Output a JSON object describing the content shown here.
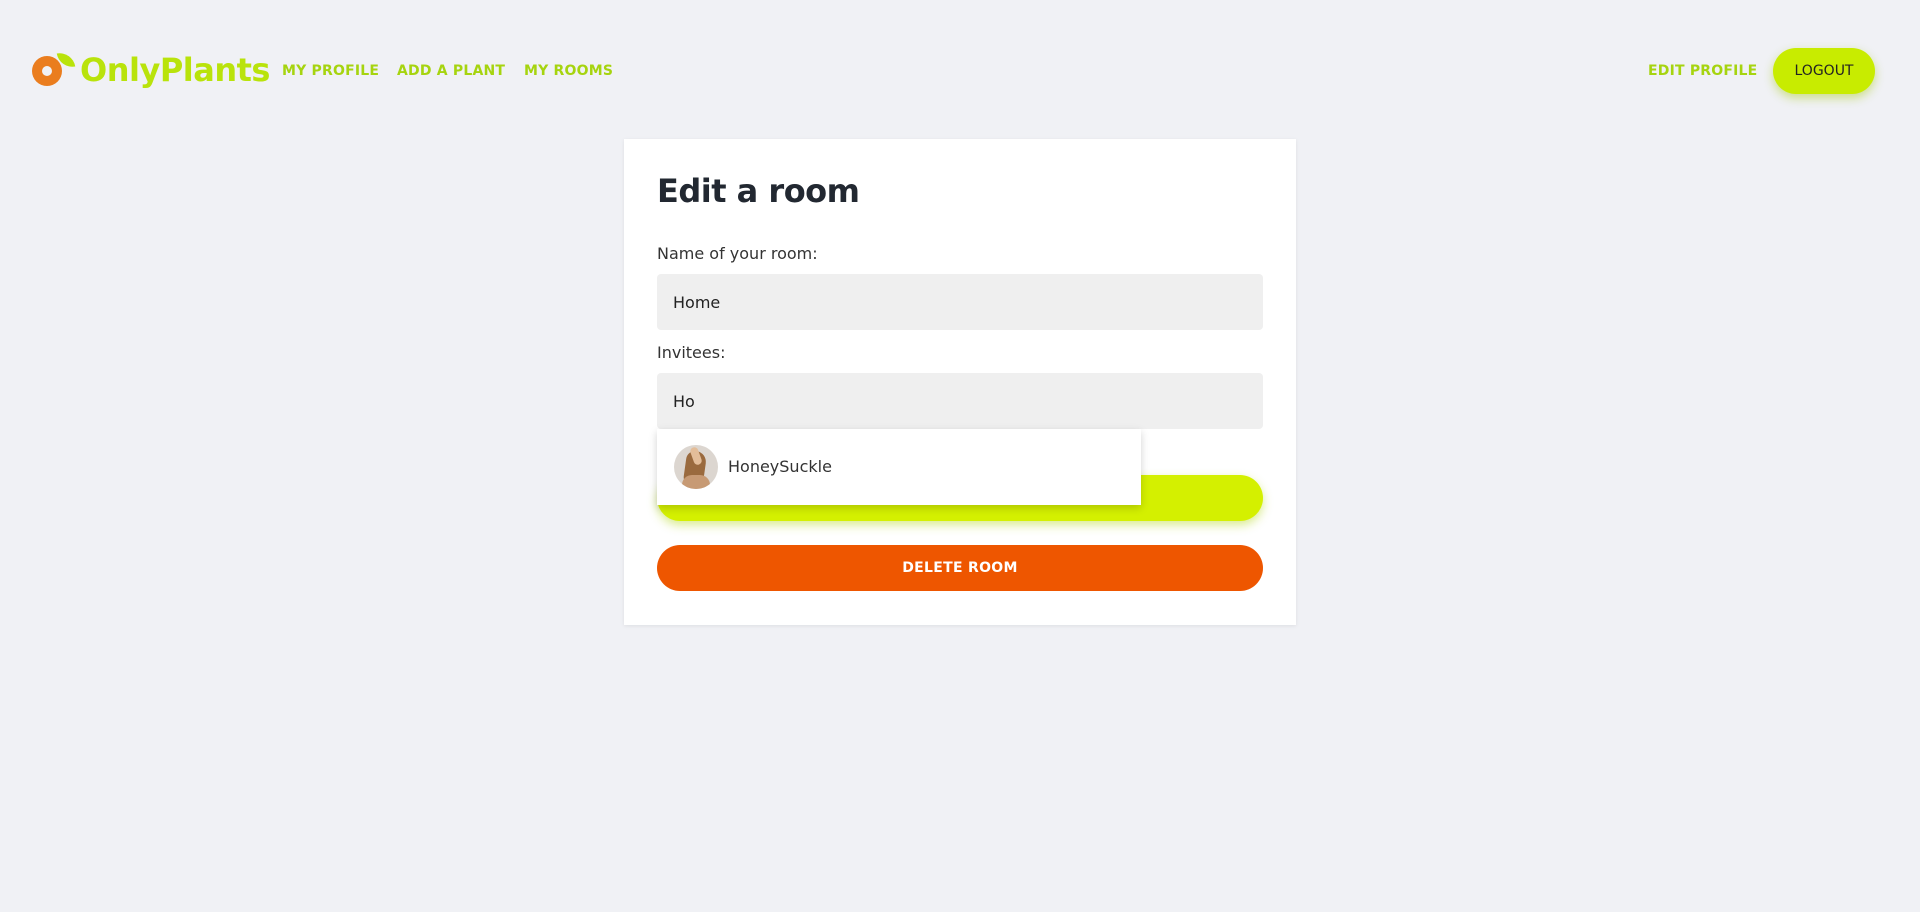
{
  "header": {
    "logo_text": "OnlyPlants",
    "nav": {
      "my_profile": "MY PROFILE",
      "add_plant": "ADD A PLANT",
      "my_rooms": "MY ROOMS",
      "edit_profile": "EDIT PROFILE"
    },
    "logout_label": "LOGOUT"
  },
  "form": {
    "title": "Edit a room",
    "room_name_label": "Name of your room:",
    "room_name_value": "Home",
    "invitees_label": "Invitees:",
    "invitees_value": "Ho",
    "save_label": "",
    "delete_label": "DELETE ROOM"
  },
  "suggestions": [
    {
      "name": "HoneySuckle",
      "avatar": "user-avatar"
    }
  ],
  "colors": {
    "brand_green": "#b9e30b",
    "accent_lime": "#d4f000",
    "logo_orange": "#ea7d1e",
    "danger_orange": "#ee5600",
    "page_bg": "#f0f1f5",
    "input_bg": "#efefef"
  }
}
